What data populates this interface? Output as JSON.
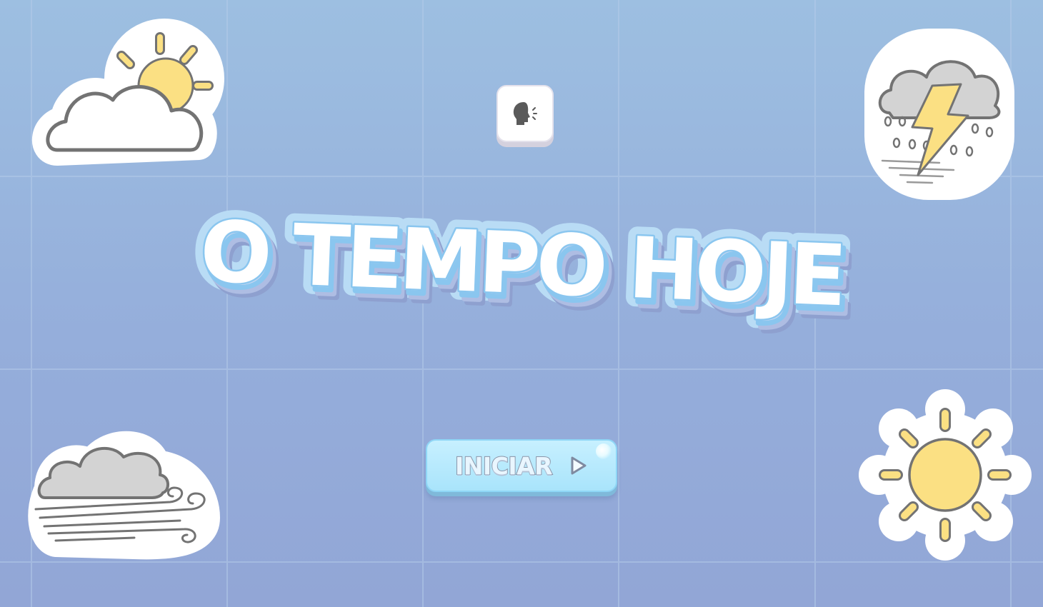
{
  "screen": {
    "title": "O TEMPO HOJE",
    "start_button_label": "INICIAR"
  },
  "icons": {
    "speak_button": "speaking-head-icon",
    "start_button": "play-triangle-icon",
    "top_left_sticker": "sun-behind-cloud-icon",
    "top_right_sticker": "thunderstorm-rain-icon",
    "bottom_left_sticker": "windy-cloud-icon",
    "bottom_right_sticker": "sun-icon"
  },
  "colors": {
    "background_top": "#9dbfe1",
    "background_bottom": "#92a6d6",
    "title_fill": "#ffffff",
    "title_outline": "#8ac6ef",
    "start_button_fill": "#b5e9fd",
    "sun_yellow": "#fbe083",
    "cloud_gray": "#d3d3d3"
  }
}
